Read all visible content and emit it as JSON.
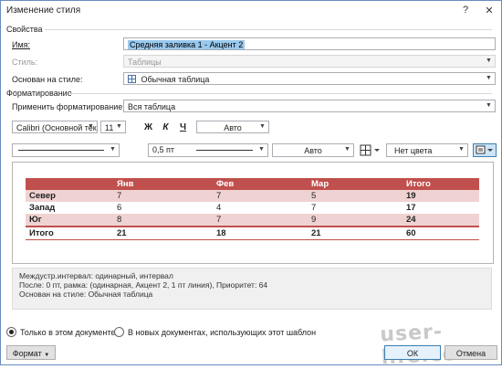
{
  "window": {
    "title": "Изменение стиля",
    "help_glyph": "?",
    "close_glyph": "✕"
  },
  "properties": {
    "section": "Свойства",
    "name_label": "Имя:",
    "name_value": "Средняя заливка 1 - Акцент 2",
    "style_type_label": "Стиль:",
    "style_type_value": "Таблицы",
    "based_on_label": "Основан на стиле:",
    "based_on_value": "Обычная таблица"
  },
  "formatting": {
    "section": "Форматирование",
    "apply_to_label": "Применить форматирование к:",
    "apply_to_value": "Вся таблица",
    "font": "Calibri (Основной тек",
    "size": "11",
    "bold": "Ж",
    "italic": "К",
    "underline": "Ч",
    "font_color": "Авто",
    "border_width": "0,5 пт",
    "border_color": "Авто",
    "shading": "Нет цвета"
  },
  "preview_table": {
    "header": [
      "",
      "Янв",
      "Фев",
      "Мар",
      "Итого"
    ],
    "rows": [
      [
        "Север",
        "7",
        "7",
        "5",
        "19"
      ],
      [
        "Запад",
        "6",
        "4",
        "7",
        "17"
      ],
      [
        "Юг",
        "8",
        "7",
        "9",
        "24"
      ],
      [
        "Итого",
        "21",
        "18",
        "21",
        "60"
      ]
    ],
    "colors": {
      "header": "#c0504d",
      "band": "#efd3d2",
      "border": "#c0504d"
    }
  },
  "description": {
    "line1": "Междустр.интервал:  одинарный, интервал",
    "line2": "После:  0 пт, рамка: (одинарная, Акцент 2,  1 пт линия), Приоритет: 64",
    "line3": "Основан на стиле: Обычная таблица"
  },
  "scope": {
    "this_document": "Только в этом документе",
    "new_documents": "В новых документах, использующих этот шаблон"
  },
  "footer": {
    "format_button": "Формат",
    "ok_button": "ОК",
    "cancel_button": "Отмена",
    "watermark": "user-life.com"
  }
}
